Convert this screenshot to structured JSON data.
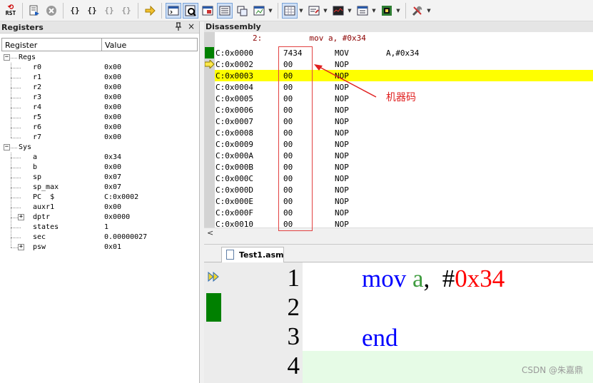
{
  "toolbar": {
    "reset_label": "RST",
    "brace_icons": [
      "{}",
      "{}",
      "{}",
      "{}"
    ]
  },
  "registers": {
    "title": "Registers",
    "pin_glyph": "\u0002",
    "close_glyph": "×",
    "header_register": "Register",
    "header_value": "Value",
    "groups": [
      {
        "name": "Regs",
        "items": [
          {
            "name": "r0",
            "value": "0x00"
          },
          {
            "name": "r1",
            "value": "0x00"
          },
          {
            "name": "r2",
            "value": "0x00"
          },
          {
            "name": "r3",
            "value": "0x00"
          },
          {
            "name": "r4",
            "value": "0x00"
          },
          {
            "name": "r5",
            "value": "0x00"
          },
          {
            "name": "r6",
            "value": "0x00"
          },
          {
            "name": "r7",
            "value": "0x00"
          }
        ]
      },
      {
        "name": "Sys",
        "items": [
          {
            "name": "a",
            "value": "0x34"
          },
          {
            "name": "b",
            "value": "0x00"
          },
          {
            "name": "sp",
            "value": "0x07"
          },
          {
            "name": "sp_max",
            "value": "0x07"
          },
          {
            "name": "PC  $",
            "value": "C:0x0002"
          },
          {
            "name": "auxr1",
            "value": "0x00"
          },
          {
            "name": "dptr",
            "value": "0x0000"
          },
          {
            "name": "states",
            "value": "1"
          },
          {
            "name": "sec",
            "value": "0.00000027"
          },
          {
            "name": "psw",
            "value": "0x01"
          }
        ]
      }
    ]
  },
  "disassembly": {
    "title": "Disassembly",
    "source_line": "        2:          mov a, #0x34",
    "rows": [
      {
        "addr": "C:0x0000",
        "code": "7434",
        "mnem": "MOV",
        "ops": "A,#0x34"
      },
      {
        "addr": "C:0x0002",
        "code": "00",
        "mnem": "NOP",
        "ops": ""
      },
      {
        "addr": "C:0x0003",
        "code": "00",
        "mnem": "NOP",
        "ops": ""
      },
      {
        "addr": "C:0x0004",
        "code": "00",
        "mnem": "NOP",
        "ops": ""
      },
      {
        "addr": "C:0x0005",
        "code": "00",
        "mnem": "NOP",
        "ops": ""
      },
      {
        "addr": "C:0x0006",
        "code": "00",
        "mnem": "NOP",
        "ops": ""
      },
      {
        "addr": "C:0x0007",
        "code": "00",
        "mnem": "NOP",
        "ops": ""
      },
      {
        "addr": "C:0x0008",
        "code": "00",
        "mnem": "NOP",
        "ops": ""
      },
      {
        "addr": "C:0x0009",
        "code": "00",
        "mnem": "NOP",
        "ops": ""
      },
      {
        "addr": "C:0x000A",
        "code": "00",
        "mnem": "NOP",
        "ops": ""
      },
      {
        "addr": "C:0x000B",
        "code": "00",
        "mnem": "NOP",
        "ops": ""
      },
      {
        "addr": "C:0x000C",
        "code": "00",
        "mnem": "NOP",
        "ops": ""
      },
      {
        "addr": "C:0x000D",
        "code": "00",
        "mnem": "NOP",
        "ops": ""
      },
      {
        "addr": "C:0x000E",
        "code": "00",
        "mnem": "NOP",
        "ops": ""
      },
      {
        "addr": "C:0x000F",
        "code": "00",
        "mnem": "NOP",
        "ops": ""
      },
      {
        "addr": "C:0x0010",
        "code": "00",
        "mnem": "NOP",
        "ops": ""
      }
    ],
    "scroll_left": "<",
    "annotation": "机器码"
  },
  "editor": {
    "tab_label": "Test1.asm",
    "line_numbers": [
      "1",
      "2",
      "3",
      "4"
    ],
    "line1": {
      "kw": "mov",
      "reg": "a",
      "comma": ",",
      "hash": "#",
      "num": "0x34"
    },
    "line3": {
      "kw": "end"
    },
    "watermark": "CSDN @朱嘉鼎"
  },
  "colors": {
    "keyword": "#0000ff",
    "register": "#3f9c3f",
    "number": "#ff0000",
    "highlight": "#ffff00",
    "breakpoint": "#008000"
  }
}
